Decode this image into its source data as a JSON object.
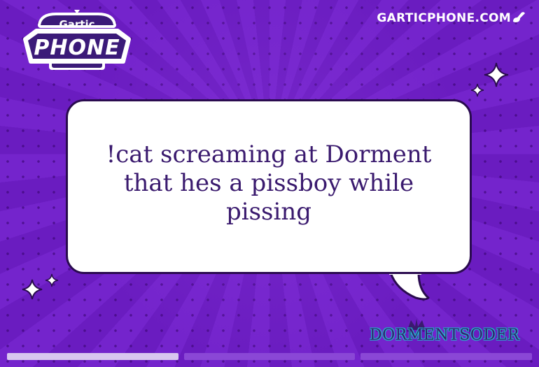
{
  "header": {
    "logo_small": "Gartic",
    "logo_large": "PHONE",
    "site_url": "GARTICPHONE.COM",
    "site_icon": "brush-icon"
  },
  "card": {
    "prompt_text": "!cat screaming at Dorment that hes a pissboy while pissing",
    "author": "DORMENTSODER"
  },
  "progress": {
    "total_steps": 3,
    "current_step": 1
  },
  "colors": {
    "background": "#6f1fc7",
    "bubble": "#ffffff",
    "text": "#3a1a6e",
    "accent": "#1fb7c8"
  }
}
